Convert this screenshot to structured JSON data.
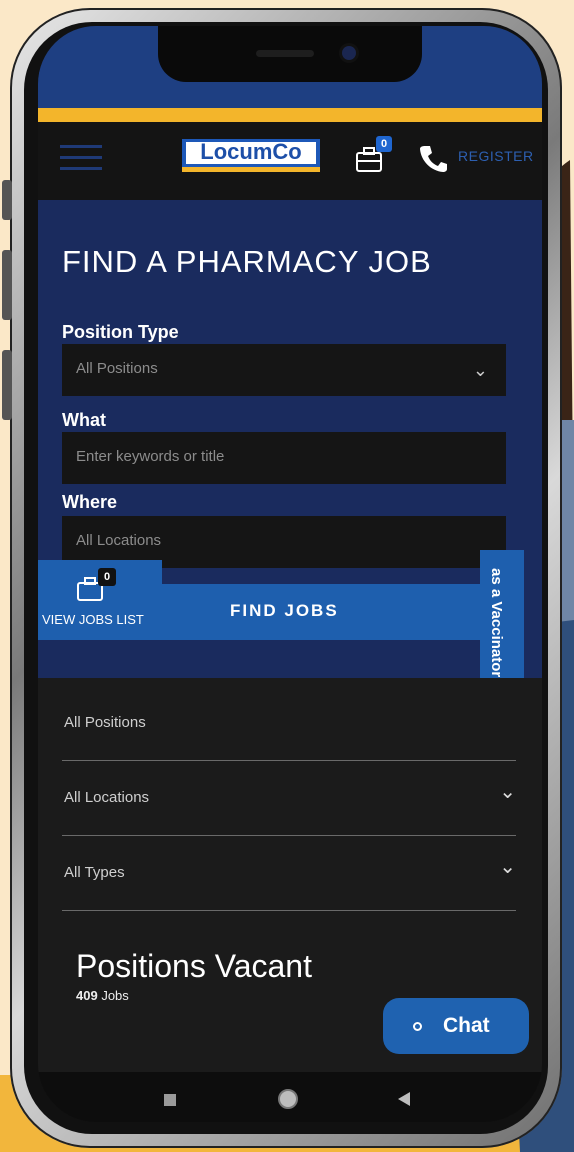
{
  "colors": {
    "accent": "#1e5fae",
    "brand_yellow": "#f3b52b",
    "hero_bg": "#1a2b5e"
  },
  "header": {
    "logo": "LocumCo",
    "cart_count": "0",
    "register_label": "REGISTER",
    "icons": [
      "menu-icon",
      "briefcase-icon",
      "phone-icon"
    ]
  },
  "search": {
    "title": "FIND A PHARMACY JOB",
    "position_type_label": "Position Type",
    "position_type_value": "All Positions",
    "what_label": "What",
    "what_placeholder": "Enter keywords or title",
    "where_label": "Where",
    "where_value": "All Locations",
    "find_button": "FIND JOBS"
  },
  "jobs_list_tab": {
    "count": "0",
    "label": "VIEW JOBS LIST"
  },
  "side_tab": {
    "label": "as a Vaccinator"
  },
  "filters": [
    "All Positions",
    "All Locations",
    "All Types"
  ],
  "results": {
    "heading": "Positions Vacant",
    "count": "409",
    "count_suffix": " Jobs"
  },
  "chat": {
    "label": "Chat"
  }
}
